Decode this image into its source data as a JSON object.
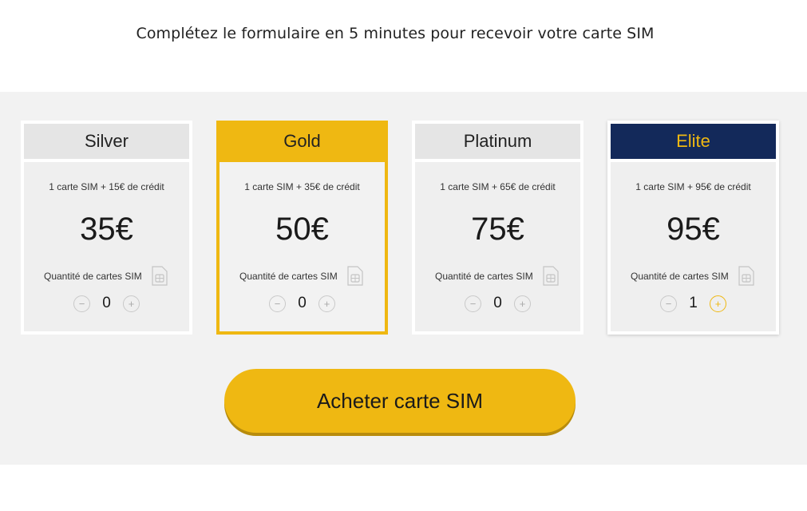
{
  "header": {
    "title": "Complétez le formulaire en 5 minutes pour recevoir votre carte SIM"
  },
  "plans": [
    {
      "name": "Silver",
      "desc": "1 carte SIM + 15€ de crédit",
      "price": "35€",
      "qty_label": "Quantité de cartes SIM",
      "qty": "0",
      "minus": "−",
      "plus": "+"
    },
    {
      "name": "Gold",
      "desc": "1 carte SIM + 35€ de crédit",
      "price": "50€",
      "qty_label": "Quantité de cartes SIM",
      "qty": "0",
      "minus": "−",
      "plus": "+"
    },
    {
      "name": "Platinum",
      "desc": "1 carte SIM + 65€ de crédit",
      "price": "75€",
      "qty_label": "Quantité de cartes SIM",
      "qty": "0",
      "minus": "−",
      "plus": "+"
    },
    {
      "name": "Elite",
      "desc": "1 carte SIM + 95€ de crédit",
      "price": "95€",
      "qty_label": "Quantité de cartes SIM",
      "qty": "1",
      "minus": "−",
      "plus": "+"
    }
  ],
  "cta": {
    "label": "Acheter carte SIM"
  },
  "colors": {
    "accent": "#efb812",
    "elite_header": "#13295a",
    "band": "#f2f2f2"
  },
  "icons": {
    "sim": "sim-card-icon"
  }
}
